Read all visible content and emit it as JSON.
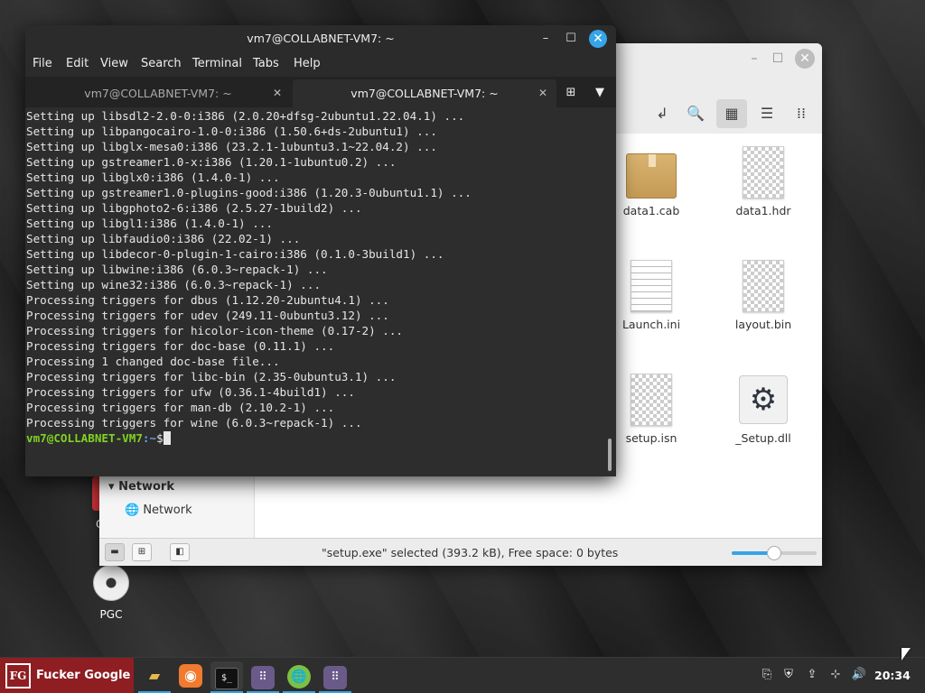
{
  "desktop": {
    "icons": [
      {
        "label": "PGC",
        "icon": "disc-icon"
      }
    ],
    "partial_icon_label": "C"
  },
  "file_manager": {
    "sidebar": {
      "section_heading": "Network",
      "items": [
        {
          "label": "Network",
          "icon": "globe-icon"
        }
      ]
    },
    "files": [
      {
        "name": "data1.cab",
        "icon": "archive-icon"
      },
      {
        "name": "data1.hdr",
        "icon": "generic-file-icon"
      },
      {
        "name": "Launch.ini",
        "icon": "text-file-icon"
      },
      {
        "name": "layout.bin",
        "icon": "generic-file-icon"
      },
      {
        "name": "setup.isn",
        "icon": "generic-file-icon"
      },
      {
        "name": "_Setup.dll",
        "icon": "gear-icon"
      }
    ],
    "status_text": "\"setup.exe\" selected (393.2 kB), Free space: 0 bytes",
    "zoom_level": 0.5,
    "accent_color": "#35a4e8"
  },
  "terminal": {
    "title": "vm7@COLLABNET-VM7: ~",
    "menu": [
      "File",
      "Edit",
      "View",
      "Search",
      "Terminal",
      "Tabs",
      "Help"
    ],
    "tabs": [
      {
        "label": "vm7@COLLABNET-VM7: ~",
        "active": false
      },
      {
        "label": "vm7@COLLABNET-VM7: ~",
        "active": true
      }
    ],
    "output_lines": [
      "Setting up libsdl2-2.0-0:i386 (2.0.20+dfsg-2ubuntu1.22.04.1) ...",
      "Setting up libpangocairo-1.0-0:i386 (1.50.6+ds-2ubuntu1) ...",
      "Setting up libglx-mesa0:i386 (23.2.1-1ubuntu3.1~22.04.2) ...",
      "Setting up gstreamer1.0-x:i386 (1.20.1-1ubuntu0.2) ...",
      "Setting up libglx0:i386 (1.4.0-1) ...",
      "Setting up gstreamer1.0-plugins-good:i386 (1.20.3-0ubuntu1.1) ...",
      "Setting up libgphoto2-6:i386 (2.5.27-1build2) ...",
      "Setting up libgl1:i386 (1.4.0-1) ...",
      "Setting up libfaudio0:i386 (22.02-1) ...",
      "Setting up libdecor-0-plugin-1-cairo:i386 (0.1.0-3build1) ...",
      "Setting up libwine:i386 (6.0.3~repack-1) ...",
      "Setting up wine32:i386 (6.0.3~repack-1) ...",
      "Processing triggers for dbus (1.12.20-2ubuntu4.1) ...",
      "Processing triggers for udev (249.11-0ubuntu3.12) ...",
      "Processing triggers for hicolor-icon-theme (0.17-2) ...",
      "Processing triggers for doc-base (0.11.1) ...",
      "Processing 1 changed doc-base file...",
      "Processing triggers for libc-bin (2.35-0ubuntu3.1) ...",
      "Processing triggers for ufw (0.36.1-4build1) ...",
      "Processing triggers for man-db (2.10.2-1) ...",
      "Processing triggers for wine (6.0.3~repack-1) ..."
    ],
    "prompt_user": "vm7@COLLABNET-VM7",
    "prompt_path": ":~",
    "prompt_symbol": "$",
    "prompt_user_color": "#7fd323",
    "prompt_path_color": "#6aa0e8"
  },
  "taskbar": {
    "start_logo": "FG",
    "start_label": "Fucker Google",
    "start_color": "#8e1e22",
    "apps": [
      {
        "name": "file-manager",
        "icon": "folder-icon"
      },
      {
        "name": "firefox",
        "icon": "firefox-icon"
      },
      {
        "name": "terminal",
        "icon": "terminal-icon"
      },
      {
        "name": "app-grid-1",
        "icon": "app-grid-icon"
      },
      {
        "name": "browser",
        "icon": "globe-icon"
      },
      {
        "name": "app-grid-2",
        "icon": "app-grid-icon"
      }
    ],
    "clock": "20:34"
  }
}
